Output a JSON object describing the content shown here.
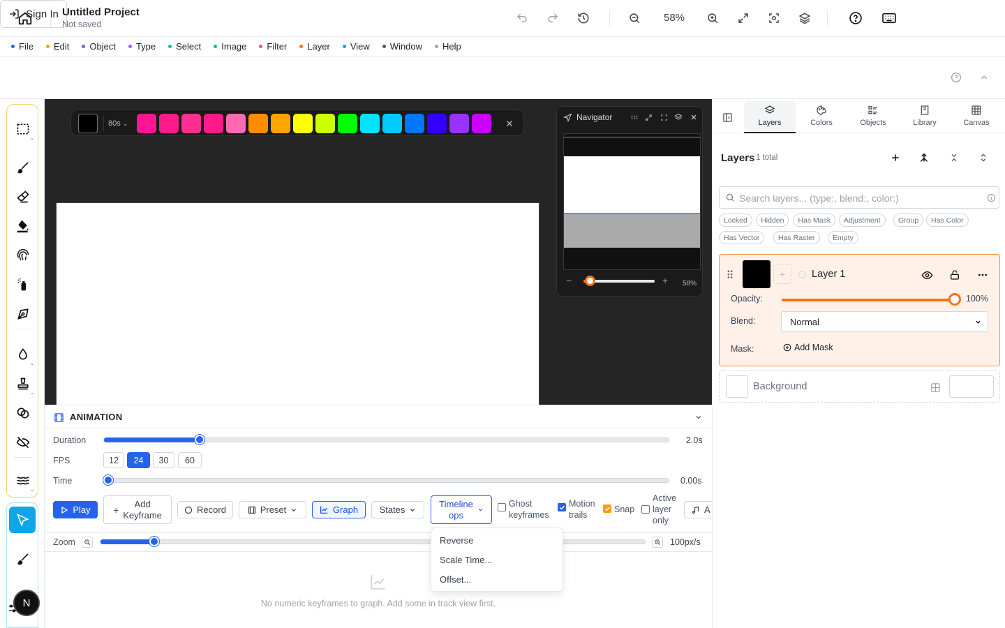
{
  "topbar": {
    "project_title": "Untitled Project",
    "project_status": "Not saved",
    "zoom": "58%",
    "signin_label": "Sign In"
  },
  "menu": [
    {
      "label": "File",
      "color": "#2563eb"
    },
    {
      "label": "Edit",
      "color": "#f59e0b"
    },
    {
      "label": "Object",
      "color": "#6366f1"
    },
    {
      "label": "Type",
      "color": "#a855f7"
    },
    {
      "label": "Select",
      "color": "#14b8a6"
    },
    {
      "label": "Image",
      "color": "#10b981"
    },
    {
      "label": "Filter",
      "color": "#ec4899"
    },
    {
      "label": "Layer",
      "color": "#f97316"
    },
    {
      "label": "View",
      "color": "#0ea5e9"
    },
    {
      "label": "Window",
      "color": "#475569"
    },
    {
      "label": "Help",
      "color": "#9ca3af"
    }
  ],
  "palette": {
    "brush_size": "80s",
    "current_color": "#000000",
    "swatches": [
      "#ff1493",
      "#ff1a8c",
      "#ff2e93",
      "#ff1a8c",
      "#ff69b4",
      "#ff8c00",
      "#ffa500",
      "#ffff00",
      "#ccff00",
      "#00ff00",
      "#00e5ff",
      "#00ccff",
      "#0077ff",
      "#3300ff",
      "#9933ff",
      "#cc00ff"
    ]
  },
  "navigator": {
    "title": "Navigator",
    "zoom": "58%"
  },
  "animation": {
    "title": "ANIMATION",
    "duration_label": "Duration",
    "duration_value": "2.0s",
    "duration_fraction": 0.17,
    "fps_label": "FPS",
    "fps_options": [
      "12",
      "24",
      "30",
      "60"
    ],
    "fps_selected": "24",
    "time_label": "Time",
    "time_value": "0.00s",
    "play_label": "Play",
    "add_keyframe_label_1": "Add",
    "add_keyframe_label_2": "Keyframe",
    "record_label": "Record",
    "preset_label": "Preset",
    "graph_label": "Graph",
    "states_label": "States",
    "timeline_ops_1": "Timeline",
    "timeline_ops_2": "ops",
    "ghost_1": "Ghost",
    "ghost_2": "keyframes",
    "motion_1": "Motion",
    "motion_2": "trails",
    "snap_label": "Snap",
    "active_1": "Active",
    "active_2": "layer",
    "active_3": "only",
    "audio_label": "A",
    "zoom_label": "Zoom",
    "zoom_value": "100px/s",
    "zoom_fraction": 0.1,
    "empty_message": "No numeric keyframes to graph. Add some in track view first.",
    "dropdown_items": [
      "Reverse",
      "Scale Time...",
      "Offset..."
    ]
  },
  "rightpanel": {
    "tabs": [
      "Layers",
      "Colors",
      "Objects",
      "Library",
      "Canvas"
    ],
    "active_tab": "Layers",
    "layers_title": "Layers",
    "layers_count": "1 total",
    "search_placeholder": "Search layers... (type:, blend:, color:)",
    "chips_row1": [
      "Locked",
      "Hidden",
      "Has Mask",
      "Adjustment",
      "Group",
      "Has Color"
    ],
    "chips_row2": [
      "Has Vector",
      "Has Raster",
      "Empty"
    ],
    "layer_name": "Layer 1",
    "opacity_label": "Opacity:",
    "opacity_value": "100%",
    "opacity_fraction": 1.0,
    "blend_label": "Blend:",
    "blend_value": "Normal",
    "mask_label": "Mask:",
    "add_mask_label": "Add Mask",
    "background_label": "Background"
  },
  "user": {
    "initial": "N"
  }
}
